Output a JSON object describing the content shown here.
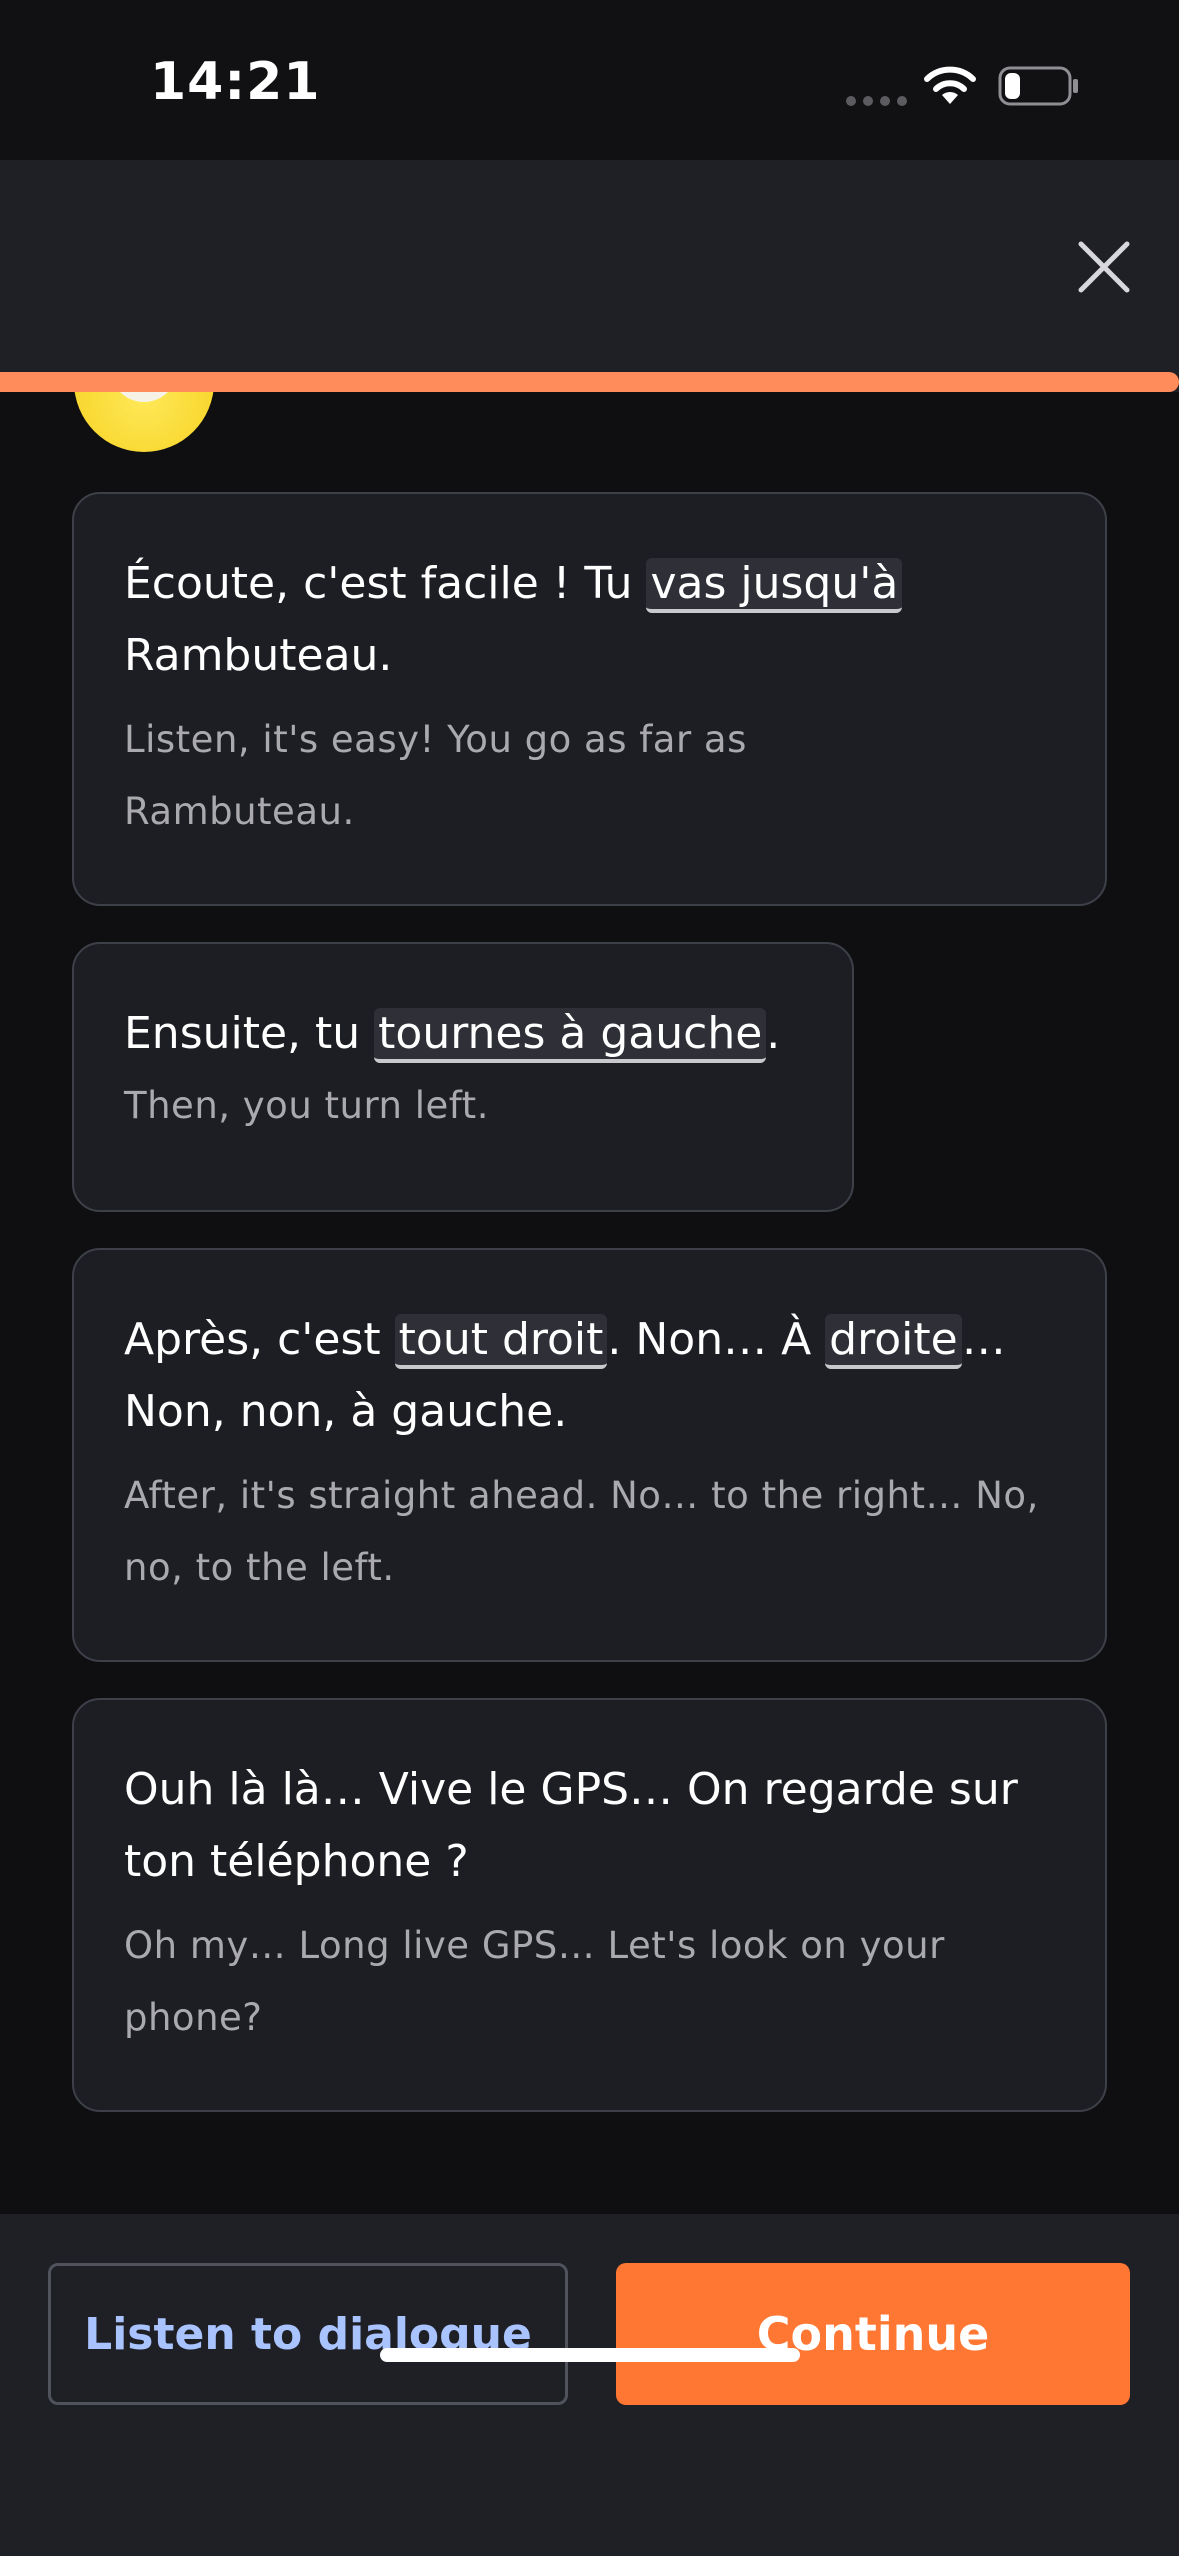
{
  "status_bar": {
    "time": "14:21",
    "battery_level": 0.25
  },
  "header": {
    "close_icon": "close-icon"
  },
  "progress": {
    "fraction": 1.0,
    "color": "#ff8c5a"
  },
  "dialogue": [
    {
      "fr_before": "Écoute, c'est facile ! Tu ",
      "fr_highlight": "vas jusqu'à",
      "fr_after": "Rambuteau.",
      "en": "Listen, it's easy! You go as far as Rambuteau."
    },
    {
      "fr_before": "Ensuite, tu ",
      "fr_highlight": "tournes à gauche",
      "fr_after": ".",
      "en": "Then, you turn left."
    },
    {
      "fr_before": "Après, c'est ",
      "fr_highlight": "tout droit",
      "fr_middle": ". Non… À ",
      "fr_highlight2": "droite",
      "fr_after": "… Non, non, à gauche.",
      "en": "After, it's straight ahead. No… to the right… No, no, to the left."
    },
    {
      "fr": "Ouh là là… Vive le GPS… On regarde sur ton téléphone ?",
      "en": "Oh my… Long live GPS… Let's look on your phone?"
    }
  ],
  "footer": {
    "listen_label": "Listen to dialogue",
    "continue_label": "Continue",
    "accent_color": "#ff7733"
  }
}
